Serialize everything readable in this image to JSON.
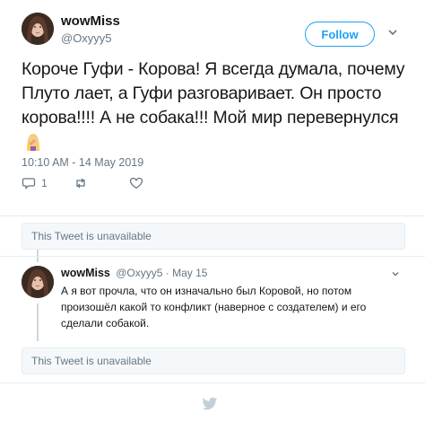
{
  "main_tweet": {
    "display_name": "wowMiss",
    "handle": "@Oxyyy5",
    "follow_label": "Follow",
    "text": "Короче Гуфи - Корова! Я всегда думала, почему Плуто лает, а Гуфи разговаривает. Он просто корова!!!! А не собака!!! Мой мир перевернулся",
    "emoji_icon": "woman-facepalming-icon",
    "timestamp": "10:10 AM - 14 May 2019",
    "reply_count": "1",
    "retweet_count": "",
    "like_count": ""
  },
  "quoted": {
    "unavailable_1": "This Tweet is unavailable",
    "unavailable_2": "This Tweet is unavailable"
  },
  "reply_tweet": {
    "display_name": "wowMiss",
    "meta": "@Oxyyy5 · May 15",
    "text": "А я вот прочла, что он изначально был Коровой, но потом произошёл какой то конфликт (наверное с создателем) и его сделали собакой."
  },
  "colors": {
    "accent": "#1da1f2",
    "muted": "#657786",
    "border": "#e6ecf0"
  },
  "icons": {
    "reply": "reply-icon",
    "retweet": "retweet-icon",
    "like": "heart-icon",
    "menu": "chevron-down-icon",
    "footer": "twitter-bird-icon"
  }
}
